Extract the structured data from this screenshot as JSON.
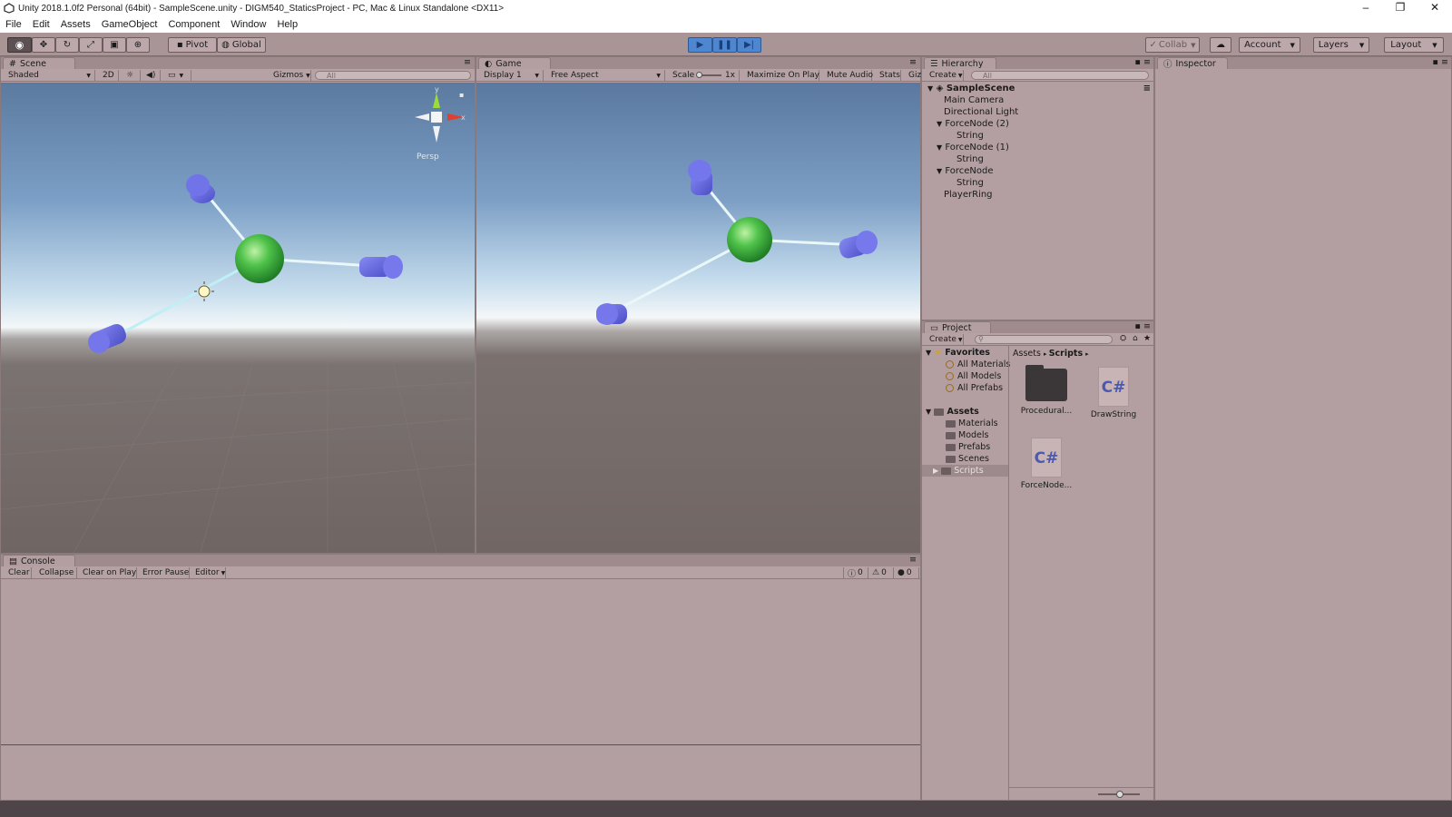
{
  "window": {
    "title": "Unity 2018.1.0f2 Personal (64bit) - SampleScene.unity - DIGM540_StaticsProject - PC, Mac & Linux Standalone <DX11>",
    "minimize": "–",
    "restore": "❐",
    "close": "✕"
  },
  "menu": [
    "File",
    "Edit",
    "Assets",
    "GameObject",
    "Component",
    "Window",
    "Help"
  ],
  "toolbar": {
    "pivot": "Pivot",
    "global": "Global",
    "collab": "Collab",
    "account": "Account",
    "layers": "Layers",
    "layout": "Layout"
  },
  "scene": {
    "tab": "Scene",
    "shading": "Shaded",
    "twod": "2D",
    "gizmos": "Gizmos",
    "search_placeholder": "All",
    "persp": "Persp",
    "axis_y": "y",
    "axis_x": "x"
  },
  "game": {
    "tab": "Game",
    "display": "Display 1",
    "aspect": "Free Aspect",
    "scale": "Scale",
    "scale_val": "1x",
    "maximize": "Maximize On Play",
    "mute": "Mute Audio",
    "stats": "Stats",
    "gizmos": "Giz"
  },
  "hierarchy": {
    "tab": "Hierarchy",
    "create": "Create",
    "search_placeholder": "All",
    "scene_name": "SampleScene",
    "items": [
      {
        "label": "Main Camera"
      },
      {
        "label": "Directional Light"
      },
      {
        "label": "ForceNode (2)"
      },
      {
        "label": "String"
      },
      {
        "label": "ForceNode (1)"
      },
      {
        "label": "String"
      },
      {
        "label": "ForceNode"
      },
      {
        "label": "String"
      },
      {
        "label": "PlayerRing"
      }
    ]
  },
  "inspector": {
    "tab": "Inspector"
  },
  "project": {
    "tab": "Project",
    "create": "Create",
    "favorites": "Favorites",
    "fav_items": [
      "All Materials",
      "All Models",
      "All Prefabs"
    ],
    "assets": "Assets",
    "asset_folders": [
      "Materials",
      "Models",
      "Prefabs",
      "Scenes",
      "Scripts"
    ],
    "breadcrumb": [
      "Assets",
      "Scripts"
    ],
    "files": [
      {
        "name": "Procedural..."
      },
      {
        "name": "DrawString",
        "glyph": "C#"
      },
      {
        "name": "ForceNode...",
        "glyph": "C#"
      }
    ]
  },
  "console": {
    "tab": "Console",
    "clear": "Clear",
    "collapse": "Collapse",
    "clear_on_play": "Clear on Play",
    "error_pause": "Error Pause",
    "editor": "Editor",
    "info_count": "0",
    "warn_count": "0",
    "error_count": "0"
  },
  "colors": {
    "accent_play": "#3c7fd6",
    "node_green": "#3fbf3f",
    "cylinder": "#6f72e6",
    "string": "#dff4f8"
  }
}
